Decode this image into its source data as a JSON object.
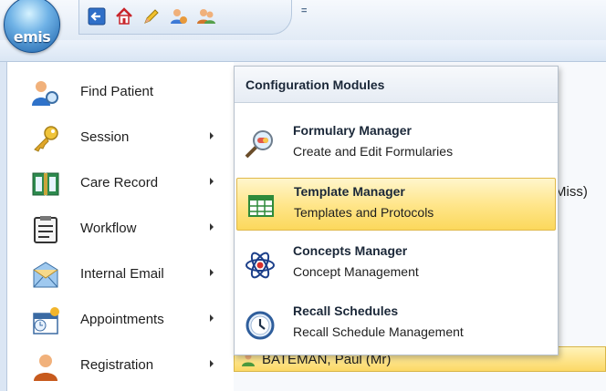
{
  "app": {
    "orb_label": "emis",
    "quick_access": [
      "back-icon",
      "home-icon",
      "edit-icon",
      "user-switch-icon",
      "users-icon"
    ],
    "quick_access_dropdown": "="
  },
  "menu": {
    "items": [
      {
        "label": "Find Patient",
        "icon": "find-patient-icon",
        "has_submenu": false
      },
      {
        "label": "Session",
        "icon": "key-icon",
        "has_submenu": true
      },
      {
        "label": "Care Record",
        "icon": "care-record-icon",
        "has_submenu": true
      },
      {
        "label": "Workflow",
        "icon": "workflow-icon",
        "has_submenu": true
      },
      {
        "label": "Internal Email",
        "icon": "email-icon",
        "has_submenu": true
      },
      {
        "label": "Appointments",
        "icon": "appointments-icon",
        "has_submenu": true
      },
      {
        "label": "Registration",
        "icon": "registration-icon",
        "has_submenu": true
      }
    ]
  },
  "panel": {
    "title": "Configuration Modules",
    "modules": [
      {
        "title": "Formulary Manager",
        "description": "Create and Edit Formularies",
        "icon": "magnifier-pill-icon",
        "selected": false
      },
      {
        "title": "Template Manager",
        "description": "Templates and Protocols",
        "icon": "template-grid-icon",
        "selected": true
      },
      {
        "title": "Concepts Manager",
        "description": "Concept Management",
        "icon": "atom-icon",
        "selected": false
      },
      {
        "title": "Recall Schedules",
        "description": "Recall Schedule Management",
        "icon": "clock-icon",
        "selected": false
      }
    ]
  },
  "background": {
    "miss_text": "Miss)",
    "patient_name": "BATEMAN, Paul (Mr)"
  },
  "colors": {
    "selection_top": "#fff6cc",
    "selection_bottom": "#fbd85c",
    "ribbon": "#dae6f4"
  }
}
